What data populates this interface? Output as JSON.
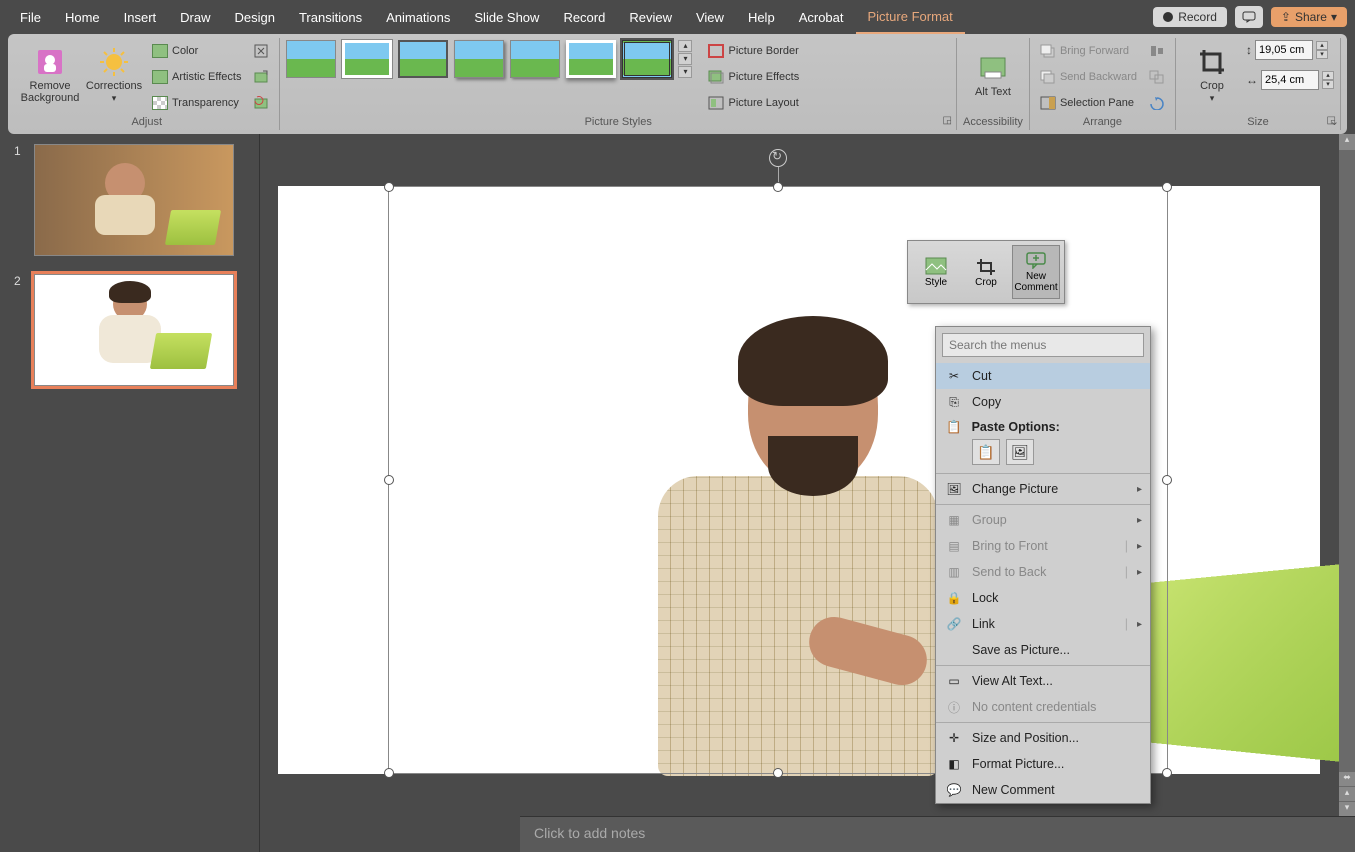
{
  "menu": {
    "tabs": [
      "File",
      "Home",
      "Insert",
      "Draw",
      "Design",
      "Transitions",
      "Animations",
      "Slide Show",
      "Record",
      "Review",
      "View",
      "Help",
      "Acrobat",
      "Picture Format"
    ],
    "active_tab": "Picture Format",
    "record": "Record",
    "share": "Share"
  },
  "ribbon": {
    "adjust": {
      "label": "Adjust",
      "remove_bg": "Remove Background",
      "corrections": "Corrections",
      "color": "Color",
      "artistic": "Artistic Effects",
      "transparency": "Transparency"
    },
    "styles": {
      "label": "Picture Styles",
      "border": "Picture Border",
      "effects": "Picture Effects",
      "layout": "Picture Layout"
    },
    "accessibility": {
      "label": "Accessibility",
      "alt_text": "Alt Text"
    },
    "arrange": {
      "label": "Arrange",
      "bring_forward": "Bring Forward",
      "send_backward": "Send Backward",
      "selection_pane": "Selection Pane"
    },
    "size": {
      "label": "Size",
      "crop": "Crop",
      "height": "19,05 cm",
      "width": "25,4 cm"
    }
  },
  "slides": {
    "s1": "1",
    "s2": "2"
  },
  "mini_toolbar": {
    "style": "Style",
    "crop": "Crop",
    "new_comment": "New Comment"
  },
  "context_menu": {
    "search_placeholder": "Search the menus",
    "cut": "Cut",
    "copy": "Copy",
    "paste_options": "Paste Options:",
    "change_picture": "Change Picture",
    "group": "Group",
    "bring_to_front": "Bring to Front",
    "send_to_back": "Send to Back",
    "lock": "Lock",
    "link": "Link",
    "save_as_picture": "Save as Picture...",
    "view_alt_text": "View Alt Text...",
    "no_credentials": "No content credentials",
    "size_position": "Size and Position...",
    "format_picture": "Format Picture...",
    "new_comment": "New Comment"
  },
  "notes": {
    "placeholder": "Click to add notes"
  }
}
